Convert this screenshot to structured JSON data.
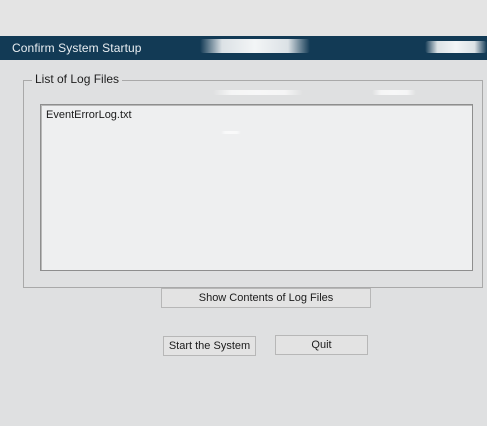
{
  "window": {
    "title": "Confirm System Startup"
  },
  "log_group": {
    "label": "List of Log Files",
    "items": [
      "EventErrorLog.txt"
    ]
  },
  "buttons": {
    "show_contents": "Show Contents of Log Files",
    "start": "Start the System",
    "quit": "Quit"
  },
  "colors": {
    "titlebar": "#123a55",
    "window_background": "#dfe0e1",
    "listbox_background": "#eeeff0"
  }
}
